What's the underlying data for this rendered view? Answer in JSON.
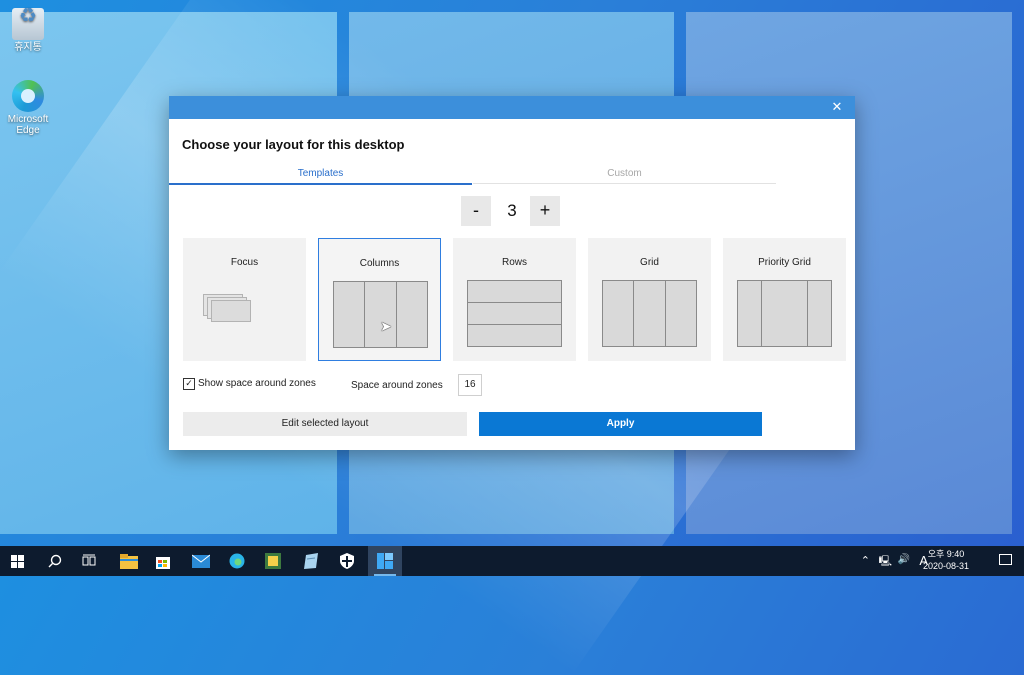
{
  "desktop": {
    "icons": [
      {
        "label": "휴지통",
        "icon": "recycle-bin-icon"
      },
      {
        "label": "Microsoft Edge",
        "icon": "edge-icon"
      }
    ]
  },
  "dialog": {
    "close_glyph": "✕",
    "title": "Choose your layout for this desktop",
    "tabs": [
      {
        "label": "Templates",
        "active": true
      },
      {
        "label": "Custom",
        "active": false
      }
    ],
    "zone_count": {
      "minus": "-",
      "value": "3",
      "plus": "+"
    },
    "layouts": [
      {
        "label": "Focus",
        "selected": false
      },
      {
        "label": "Columns",
        "selected": true
      },
      {
        "label": "Rows",
        "selected": false
      },
      {
        "label": "Grid",
        "selected": false
      },
      {
        "label": "Priority Grid",
        "selected": false
      }
    ],
    "show_space_checked": true,
    "show_space_label": "Show space around zones",
    "space_label": "Space around zones",
    "space_value": "16",
    "edit_button": "Edit selected layout",
    "apply_button": "Apply",
    "accent_color": "#0a78d4"
  },
  "taskbar": {
    "items": [
      "start-icon",
      "search-icon",
      "task-view-icon",
      "file-explorer-icon",
      "store-icon",
      "mail-icon",
      "edge-icon",
      "app-icon",
      "notepad-icon",
      "security-icon",
      "fancyzones-icon"
    ],
    "active_item": "fancyzones-icon",
    "tray_lang": "A",
    "clock_time": "오후 9:40",
    "clock_date": "2020-08-31"
  }
}
